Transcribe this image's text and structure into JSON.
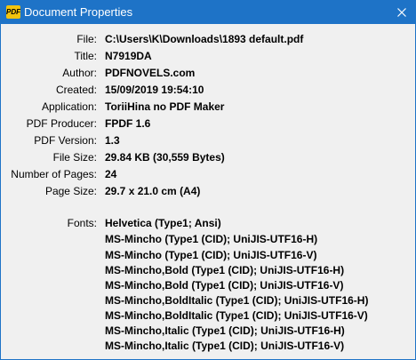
{
  "window": {
    "icon_label": "PDF",
    "title": "Document Properties",
    "close_glyph": "close-icon"
  },
  "properties": [
    {
      "label": "File:",
      "value": "C:\\Users\\K\\Downloads\\1893 default.pdf"
    },
    {
      "label": "Title:",
      "value": "N7919DA"
    },
    {
      "label": "Author:",
      "value": "PDFNOVELS.com"
    },
    {
      "label": "Created:",
      "value": "15/09/2019 19:54:10"
    },
    {
      "label": "Application:",
      "value": "ToriiHina no PDF Maker"
    },
    {
      "label": "PDF Producer:",
      "value": "FPDF 1.6"
    },
    {
      "label": "PDF Version:",
      "value": "1.3"
    },
    {
      "label": "File Size:",
      "value": "29.84 KB (30,559 Bytes)"
    },
    {
      "label": "Number of Pages:",
      "value": "24"
    },
    {
      "label": "Page Size:",
      "value": "29.7 x 21.0 cm (A4)"
    }
  ],
  "fonts": {
    "label": "Fonts:",
    "items": [
      "Helvetica (Type1; Ansi)",
      "MS-Mincho (Type1 (CID); UniJIS-UTF16-H)",
      "MS-Mincho (Type1 (CID); UniJIS-UTF16-V)",
      "MS-Mincho,Bold (Type1 (CID); UniJIS-UTF16-H)",
      "MS-Mincho,Bold (Type1 (CID); UniJIS-UTF16-V)",
      "MS-Mincho,BoldItalic (Type1 (CID); UniJIS-UTF16-H)",
      "MS-Mincho,BoldItalic (Type1 (CID); UniJIS-UTF16-V)",
      "MS-Mincho,Italic (Type1 (CID); UniJIS-UTF16-H)",
      "MS-Mincho,Italic (Type1 (CID); UniJIS-UTF16-V)"
    ]
  },
  "colors": {
    "titlebar": "#1e73c7",
    "background": "#f0f0f0",
    "icon": "#f2c40e"
  }
}
